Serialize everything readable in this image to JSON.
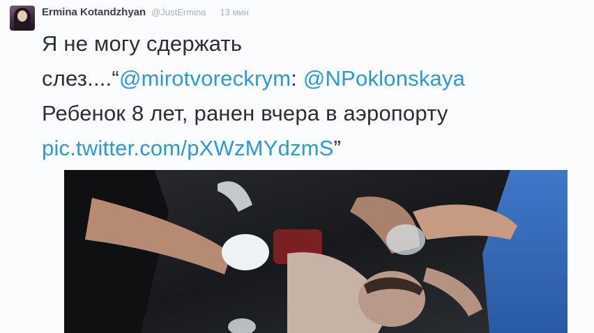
{
  "tweet": {
    "author": {
      "display_name": "Ermina Kotandzhyan",
      "handle": "@JustErmina",
      "avatar_icon": "avatar-photo"
    },
    "time_ago": "13 мин",
    "text": {
      "line1": "Я не могу сдержать",
      "line2_prefix": "слез....“",
      "mention1": "@mirotvoreckrym",
      "line2_colon": ": ",
      "mention2": "@NPoklonskaya",
      "line3": "Ребенок 8 лет, ранен вчера в аэропорту",
      "link": "pic.twitter.com/pXWzMYdzmS",
      "close_quote": "”"
    },
    "media": {
      "type": "photo"
    },
    "colors": {
      "link": "#2a9ad6",
      "text": "#2b2e33",
      "muted": "#a8b0bb"
    }
  }
}
